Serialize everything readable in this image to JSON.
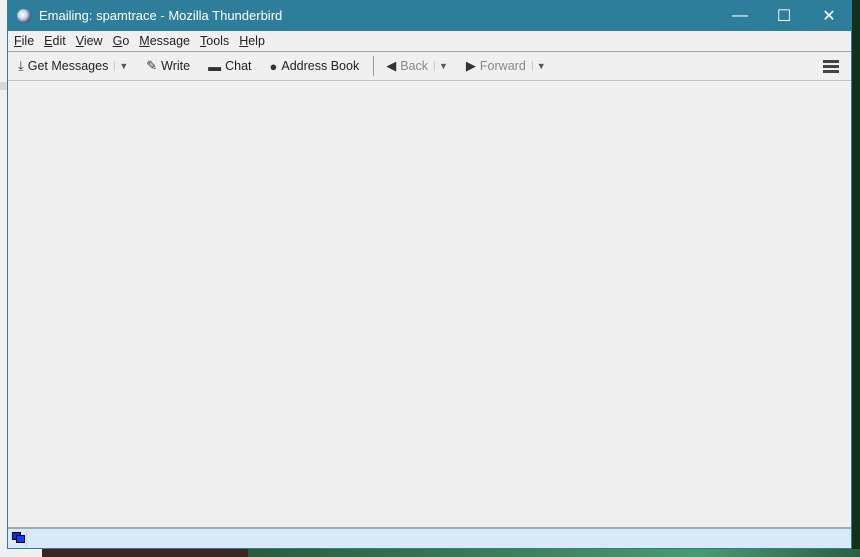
{
  "window": {
    "title": "Emailing: spamtrace - Mozilla Thunderbird",
    "minimize": "—",
    "maximize": "☐",
    "close": "✕"
  },
  "menu": [
    {
      "first": "F",
      "rest": "ile"
    },
    {
      "first": "E",
      "rest": "dit"
    },
    {
      "first": "V",
      "rest": "iew"
    },
    {
      "first": "G",
      "rest": "o"
    },
    {
      "first": "M",
      "rest": "essage"
    },
    {
      "first": "T",
      "rest": "ools"
    },
    {
      "first": "H",
      "rest": "elp"
    }
  ],
  "toolbar": {
    "get_messages": "Get Messages",
    "write": "Write",
    "chat": "Chat",
    "address_book": "Address Book",
    "back": "Back",
    "forward": "Forward"
  }
}
